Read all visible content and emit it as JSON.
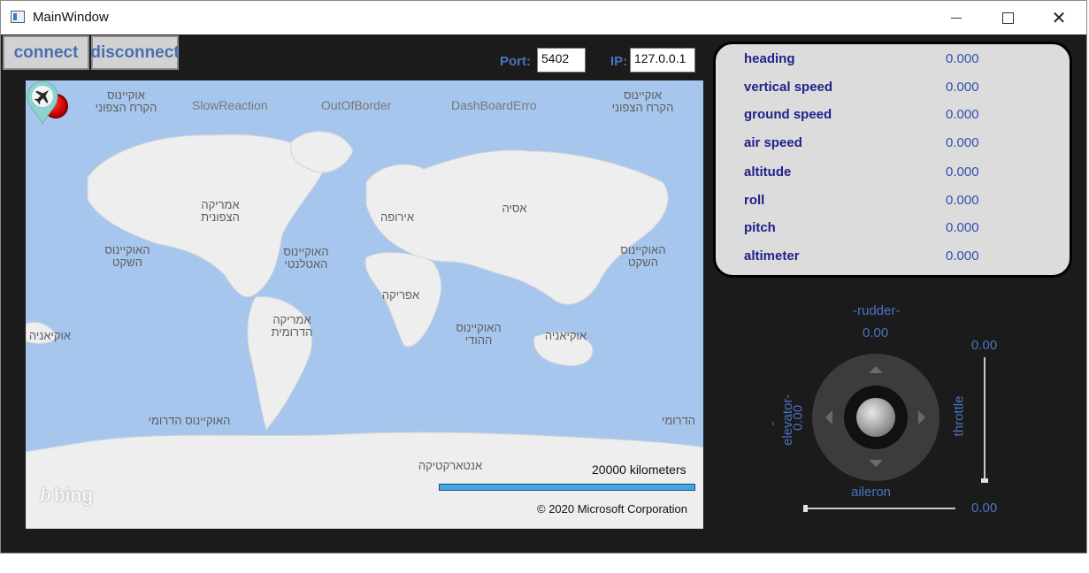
{
  "window": {
    "title": "MainWindow"
  },
  "toolbar": {
    "connect_label": "connect",
    "disconnect_label": "disconnect"
  },
  "connection": {
    "port_label": "Port:",
    "port_value": "5402",
    "ip_label": "IP:",
    "ip_value": "127.0.0.1"
  },
  "map": {
    "warnings": [
      "SlowReaction",
      "OutOfBorder",
      "DashBoardErro"
    ],
    "labels": {
      "ocean_tl": "אוקיינוס\nהקרח הצפוני",
      "ocean_tr": "אוקיינוס\nהקרח הצפוני",
      "north_america": "אמריקה\nהצפונית",
      "europe": "אירופה",
      "asia": "אסיה",
      "pacific_w": "האוקיינוס\nהשקט",
      "atlantic": "האוקיינוס\nהאטלנטי",
      "pacific_e": "האוקיינוס\nהשקט",
      "africa": "אפריקה",
      "south_america": "אמריקה\nהדרומית",
      "oceania_w": "אוקיאניה",
      "indian": "האוקיינוס\nההודי",
      "oceania_e": "אוקיאניה",
      "southern": "האוקיינוס הדרומי",
      "southern_e": "הדרומי",
      "antarctica": "אנטארקטיקה"
    },
    "scale_text": "20000 kilometers",
    "copyright": "© 2020 Microsoft Corporation",
    "brand": "bing",
    "status_color": "#e00000",
    "pin_color": "#8fd3d0"
  },
  "telemetry": [
    {
      "label": "heading",
      "value": "0.000"
    },
    {
      "label": "vertical speed",
      "value": "0.000"
    },
    {
      "label": "ground speed",
      "value": "0.000"
    },
    {
      "label": "air speed",
      "value": "0.000"
    },
    {
      "label": "altitude",
      "value": "0.000"
    },
    {
      "label": "roll",
      "value": "0.000"
    },
    {
      "label": "pitch",
      "value": "0.000"
    },
    {
      "label": "altimeter",
      "value": "0.000"
    }
  ],
  "controls": {
    "rudder_label": "-rudder-",
    "rudder_value": "0.00",
    "elevator_label": "-elevator-",
    "elevator_value": "0.00",
    "throttle_label": "throttle",
    "throttle_value": "0.00",
    "aileron_label": "aileron",
    "aileron_value": "0.00"
  }
}
